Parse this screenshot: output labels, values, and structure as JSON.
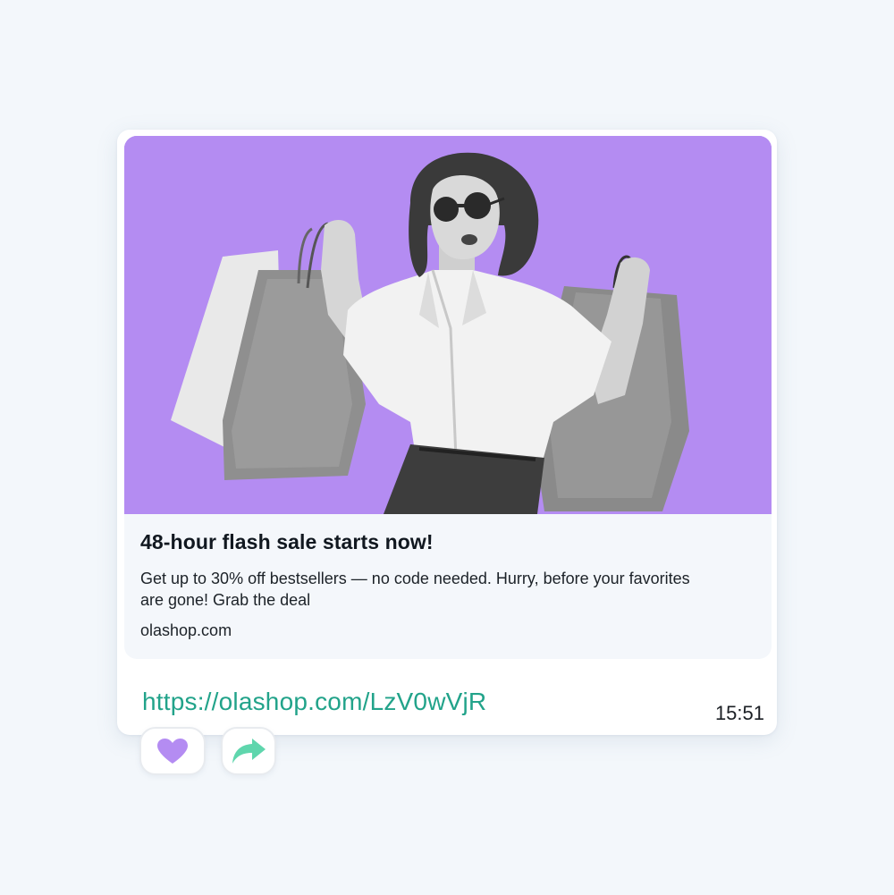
{
  "preview": {
    "image_alt": "Woman in sunglasses and white shirt holding shopping bags on a purple background",
    "title": "48-hour flash sale starts now!",
    "description": "Get up to 30% off bestsellers — no code needed.  Hurry, before your favorites are gone! Grab the deal",
    "domain": "olashop.com"
  },
  "message": {
    "link": "https://olashop.com/LzV0wVjR",
    "time": "15:51"
  },
  "reactions": {
    "like_icon": "heart-icon",
    "share_icon": "share-arrow-icon"
  },
  "colors": {
    "page_background": "#f3f7fb",
    "image_background": "#b48cf2",
    "link_color": "#22a38a",
    "heart_color": "#b48cf2",
    "share_color": "#5fd6ad"
  }
}
